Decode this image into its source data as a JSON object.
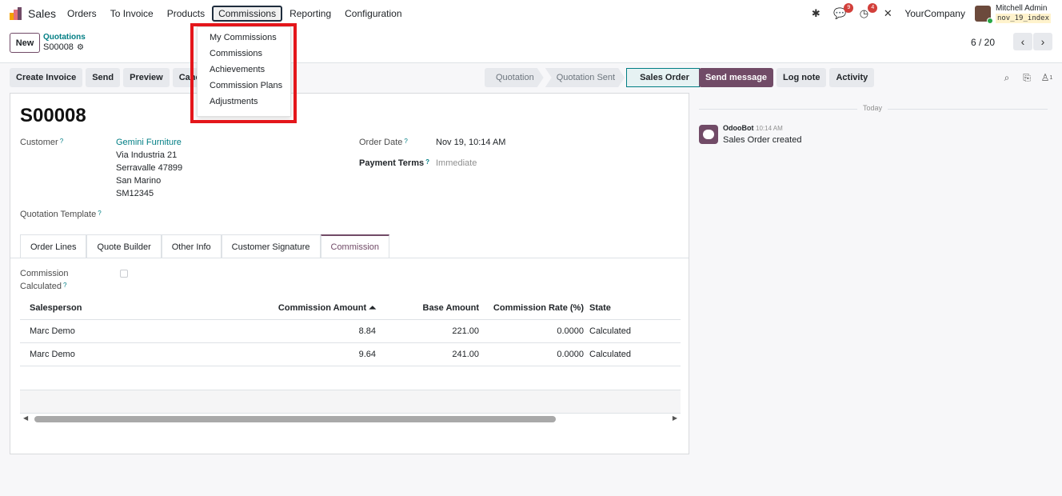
{
  "app": {
    "name": "Sales"
  },
  "menu": [
    "Orders",
    "To Invoice",
    "Products",
    "Commissions",
    "Reporting",
    "Configuration"
  ],
  "systray": {
    "messages_count": "9",
    "activities_count": "4",
    "company": "YourCompany",
    "user_name": "Mitchell Admin",
    "db_name": "nov_19_index"
  },
  "control_panel": {
    "new_label": "New",
    "breadcrumb_parent": "Quotations",
    "breadcrumb_current": "S00008",
    "pager": "6 / 20"
  },
  "actions": [
    "Create Invoice",
    "Send",
    "Preview",
    "Cancel"
  ],
  "status_stages": [
    "Quotation",
    "Quotation Sent",
    "Sales Order"
  ],
  "record": {
    "name": "S00008",
    "customer_label": "Customer",
    "customer_name": "Gemini Furniture",
    "address": [
      "Via Industria 21",
      "Serravalle 47899",
      "San Marino",
      "SM12345"
    ],
    "order_date_label": "Order Date",
    "order_date": "Nov 19, 10:14 AM",
    "payment_terms_label": "Payment Terms",
    "payment_terms": "Immediate",
    "template_label": "Quotation Template"
  },
  "tabs": [
    "Order Lines",
    "Quote Builder",
    "Other Info",
    "Customer Signature",
    "Commission"
  ],
  "commission": {
    "calc_label_1": "Commission",
    "calc_label_2": "Calculated",
    "columns": [
      "Salesperson",
      "Commission Amount",
      "Base Amount",
      "Commission Rate (%)",
      "State"
    ],
    "sort_indicator": "⏶",
    "rows": [
      [
        "Marc Demo",
        "8.84",
        "221.00",
        "0.0000",
        "Calculated"
      ],
      [
        "Marc Demo",
        "9.64",
        "241.00",
        "0.0000",
        "Calculated"
      ]
    ]
  },
  "chatter": {
    "send_message": "Send message",
    "log_note": "Log note",
    "activity": "Activity",
    "followers_count": "1",
    "today": "Today",
    "author": "OdooBot",
    "time": "10:14 AM",
    "body": "Sales Order created"
  },
  "commissions_dropdown": [
    "My Commissions",
    "Commissions",
    "Achievements",
    "Commission Plans",
    "Adjustments"
  ],
  "colors": {
    "primary": "#714b67",
    "link": "#017e84",
    "highlight": "#e4161b"
  }
}
